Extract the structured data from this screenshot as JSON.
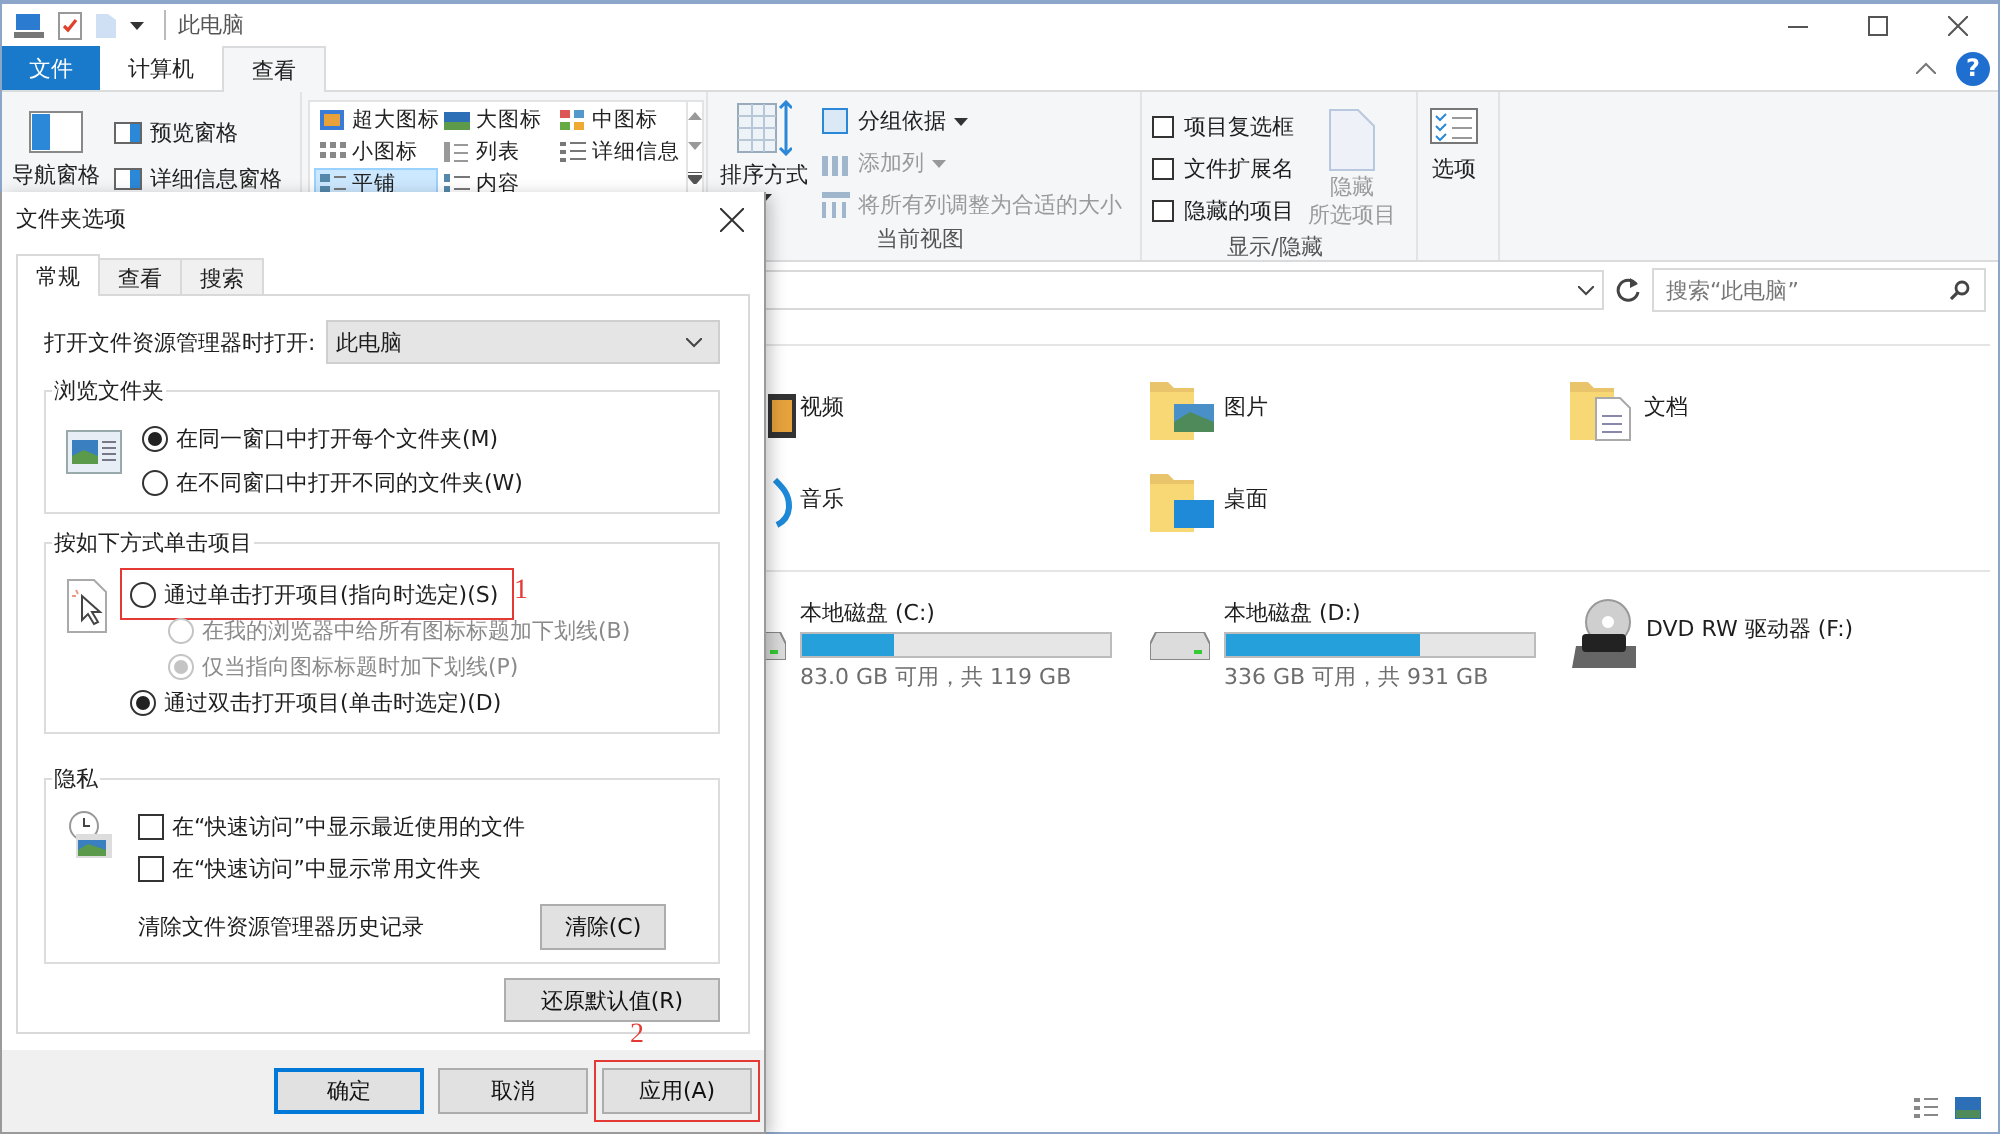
{
  "explorer": {
    "title": "此电脑",
    "ribbon_tabs": [
      {
        "label": "文件",
        "kind": "file",
        "selected": false
      },
      {
        "label": "计算机",
        "kind": "tab",
        "selected": false
      },
      {
        "label": "查看",
        "kind": "tab",
        "selected": true
      }
    ],
    "help": "?",
    "ribbon": {
      "panes": [
        {
          "label": "导航窗格",
          "kind": "large"
        },
        {
          "label": "预览窗格",
          "kind": "small"
        },
        {
          "label": "详细信息窗格",
          "kind": "small"
        }
      ],
      "layouts": [
        {
          "label": "超大图标",
          "selected": false
        },
        {
          "label": "大图标",
          "selected": false
        },
        {
          "label": "中图标",
          "selected": false
        },
        {
          "label": "小图标",
          "selected": false
        },
        {
          "label": "列表",
          "selected": false
        },
        {
          "label": "详细信息",
          "selected": false
        },
        {
          "label": "平铺",
          "selected": true
        },
        {
          "label": "内容",
          "selected": false
        }
      ],
      "current_view": {
        "sort": "排序方式",
        "items": [
          {
            "label": "分组依据",
            "disabled": false,
            "caret": true
          },
          {
            "label": "添加列",
            "disabled": true,
            "caret": true
          },
          {
            "label": "将所有列调整为合适的大小",
            "disabled": true,
            "caret": false
          }
        ],
        "label": "当前视图"
      },
      "show_hide": {
        "checkboxes": [
          {
            "label": "项目复选框",
            "checked": false
          },
          {
            "label": "文件扩展名",
            "checked": false
          },
          {
            "label": "隐藏的项目",
            "checked": false
          }
        ],
        "hide_selected": {
          "lines": [
            "隐藏",
            "所选项目"
          ],
          "disabled": true
        },
        "label": "显示/隐藏"
      },
      "options": "选项"
    },
    "search_placeholder": "搜索“此电脑”",
    "folders": [
      {
        "name": "视频",
        "kind": "video"
      },
      {
        "name": "图片",
        "kind": "pictures"
      },
      {
        "name": "文档",
        "kind": "documents"
      },
      {
        "name": "音乐",
        "kind": "music"
      },
      {
        "name": "桌面",
        "kind": "desktop"
      }
    ],
    "drives": [
      {
        "name": "本地磁盘 (C:)",
        "kind": "disk",
        "level": 0.3,
        "free": "83.0 GB 可用，共 119 GB"
      },
      {
        "name": "本地磁盘 (D:)",
        "kind": "disk",
        "level": 0.63,
        "free": "336 GB 可用，共 931 GB"
      },
      {
        "name": "DVD RW 驱动器 (F:)",
        "kind": "dvd"
      }
    ]
  },
  "dialog": {
    "title": "文件夹选项",
    "tabs": [
      {
        "label": "常规",
        "selected": true
      },
      {
        "label": "查看",
        "selected": false
      },
      {
        "label": "搜索",
        "selected": false
      }
    ],
    "open_in": {
      "label": "打开文件资源管理器时打开:",
      "value": "此电脑"
    },
    "browse": {
      "legend": "浏览文件夹",
      "options": [
        {
          "label": "在同一窗口中打开每个文件夹(M)",
          "selected": true
        },
        {
          "label": "在不同窗口中打开不同的文件夹(W)",
          "selected": false
        }
      ]
    },
    "click": {
      "legend": "按如下方式单击项目",
      "options": [
        {
          "label": "通过单击打开项目(指向时选定)(S)",
          "selected": false,
          "disabled": false,
          "kind": "main",
          "annotation": "1"
        },
        {
          "label": "在我的浏览器中给所有图标标题加下划线(B)",
          "selected": false,
          "disabled": true,
          "kind": "sub"
        },
        {
          "label": "仅当指向图标标题时加下划线(P)",
          "selected": true,
          "disabled": true,
          "kind": "sub"
        },
        {
          "label": "通过双击打开项目(单击时选定)(D)",
          "selected": true,
          "disabled": false,
          "kind": "main"
        }
      ]
    },
    "privacy": {
      "legend": "隐私",
      "checkboxes": [
        {
          "label": "在“快速访问”中显示最近使用的文件",
          "checked": false
        },
        {
          "label": "在“快速访问”中显示常用文件夹",
          "checked": false
        }
      ],
      "clear_label": "清除文件资源管理器历史记录",
      "clear_button": "清除(C)"
    },
    "restore_button": "还原默认值(R)",
    "buttons": [
      {
        "label": "确定",
        "kind": "default"
      },
      {
        "label": "取消",
        "kind": "normal"
      },
      {
        "label": "应用(A)",
        "kind": "normal",
        "annotation": "2"
      }
    ]
  }
}
